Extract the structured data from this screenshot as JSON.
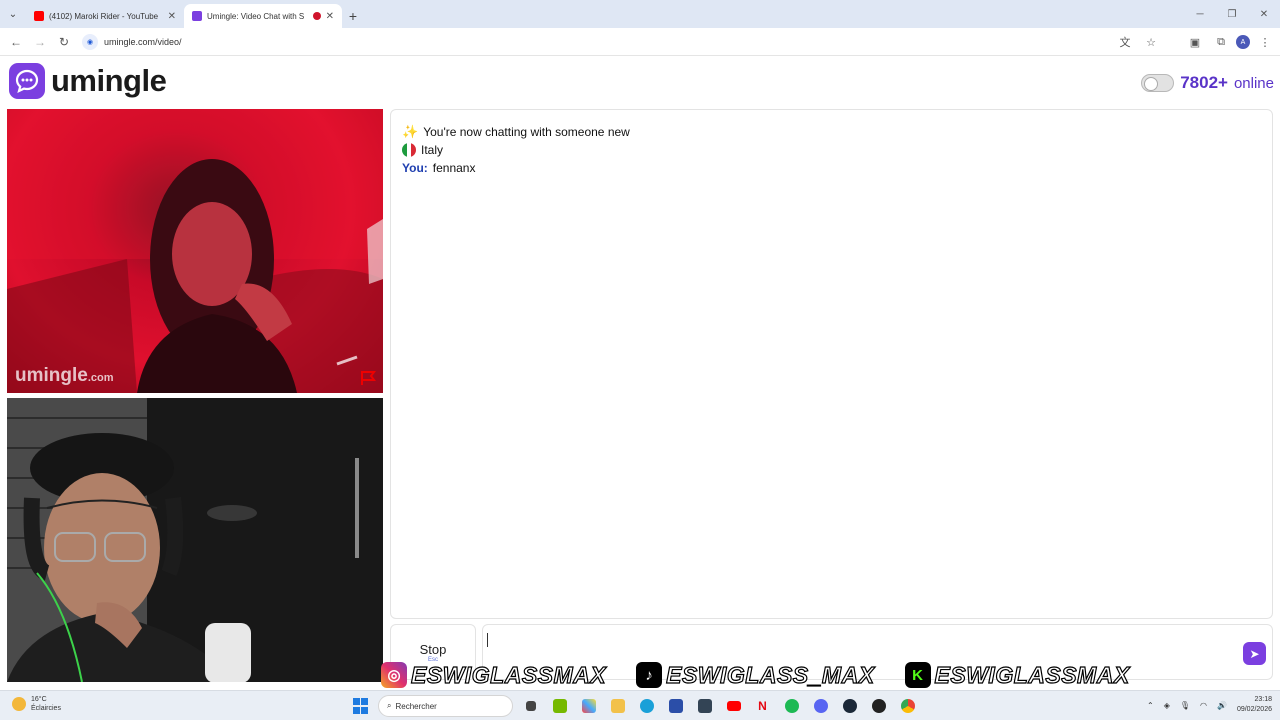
{
  "browser": {
    "tabs": [
      {
        "label": "(4102) Maroki Rider - YouTube",
        "active": false,
        "favicon_color": "#ff0000"
      },
      {
        "label": "Umingle: Video Chat with S",
        "active": true,
        "favicon_color": "#7b3fe0"
      }
    ],
    "url": "umingle.com/video/"
  },
  "header": {
    "logo_text": "umingle",
    "online_count": "7802+",
    "online_label": "online"
  },
  "videos": {
    "watermark_main": "umingle",
    "watermark_suffix": ".com"
  },
  "chat": {
    "intro": "You're now chatting with someone new",
    "country": "Italy",
    "you_label": "You:",
    "you_value": "fennanx"
  },
  "controls": {
    "stop_label": "Stop",
    "stop_hint": "Esc"
  },
  "overlay": {
    "handles": [
      {
        "platform": "instagram-icon",
        "text": "ESWIGLASSMAX"
      },
      {
        "platform": "tiktok-icon",
        "text": "ESWIGLASS_MAX"
      },
      {
        "platform": "kick-icon",
        "text": "ESWIGLASSMAX"
      }
    ]
  },
  "taskbar": {
    "temperature": "16°C",
    "weather": "Éclaircies",
    "search_placeholder": "Rechercher",
    "time": "23:18",
    "date": "09/02/2026"
  }
}
